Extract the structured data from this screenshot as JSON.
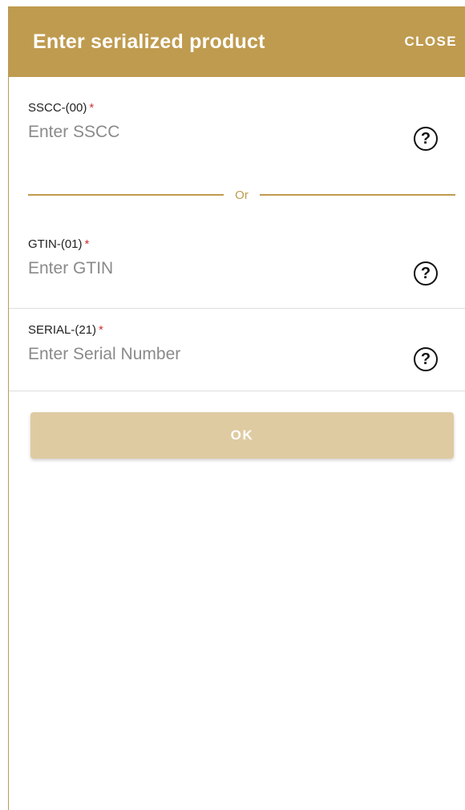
{
  "dialog": {
    "title": "Enter serialized product",
    "close_label": "CLOSE"
  },
  "fields": {
    "sscc": {
      "label": "SSCC-(00)",
      "required_mark": "*",
      "placeholder": "Enter SSCC",
      "value": ""
    },
    "separator": "Or",
    "gtin": {
      "label": "GTIN-(01)",
      "required_mark": "*",
      "placeholder": "Enter GTIN",
      "value": ""
    },
    "serial": {
      "label": "SERIAL-(21)",
      "required_mark": "*",
      "placeholder": "Enter Serial Number",
      "value": ""
    }
  },
  "help_glyph": "?",
  "icons": {
    "help": "question-circle-icon"
  },
  "actions": {
    "ok_label": "OK",
    "ok_enabled": false
  },
  "colors": {
    "header_bg": "#bf9b4f",
    "accent": "#bf9b4f",
    "required": "#d13030",
    "ok_button_disabled": "#dfcba2"
  }
}
